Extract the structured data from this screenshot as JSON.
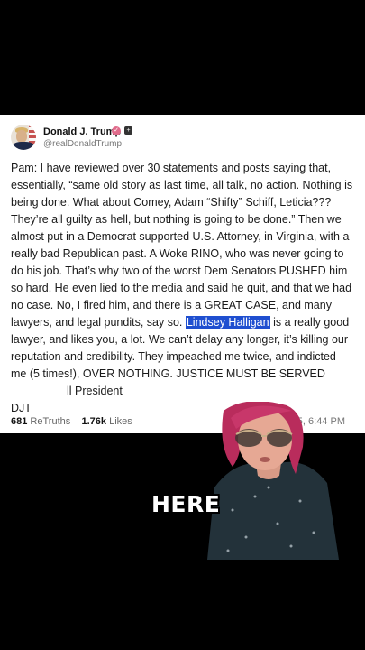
{
  "post": {
    "author_name": "Donald J. Trump",
    "handle": "@realDonaldTrump",
    "text_before": "Pam: I have reviewed over 30 statements and posts saying that, essentially, “same old story as last time, all talk, no action. Nothing is being done. What about Comey, Adam “Shifty” Schiff, Leticia??? They’re all guilty as hell, but nothing is going to be done.” Then we almost put in a Democrat supported U.S. Attorney, in Virginia, with a really bad Republican past. A Woke RINO, who was never going to do his job. That’s why two of the worst Dem Senators PUSHED him so hard. He even lied to the media and said he quit, and that we had no case. No, I fired him, and there is a GREAT CASE, and many lawyers, and legal pundits, say so. ",
    "text_highlight": "Lindsey Halligan",
    "text_after": " is a really good lawyer, and likes you, a lot. We can’t delay any longer, it’s killing our reputation and credibility. They impeached me twice, and indicted me (5 times!), OVER NOTHING. JUSTICE MUST BE SERVED",
    "text_tail": "ll President\nDJT",
    "retruths_count": "681",
    "retruths_label": "ReTruths",
    "likes_count": "1.76k",
    "likes_label": "Likes",
    "timestamp_visible": "25, 6:44 PM",
    "highlight_color": "#1f4fd0"
  },
  "overlay": {
    "caption": "HERE"
  }
}
